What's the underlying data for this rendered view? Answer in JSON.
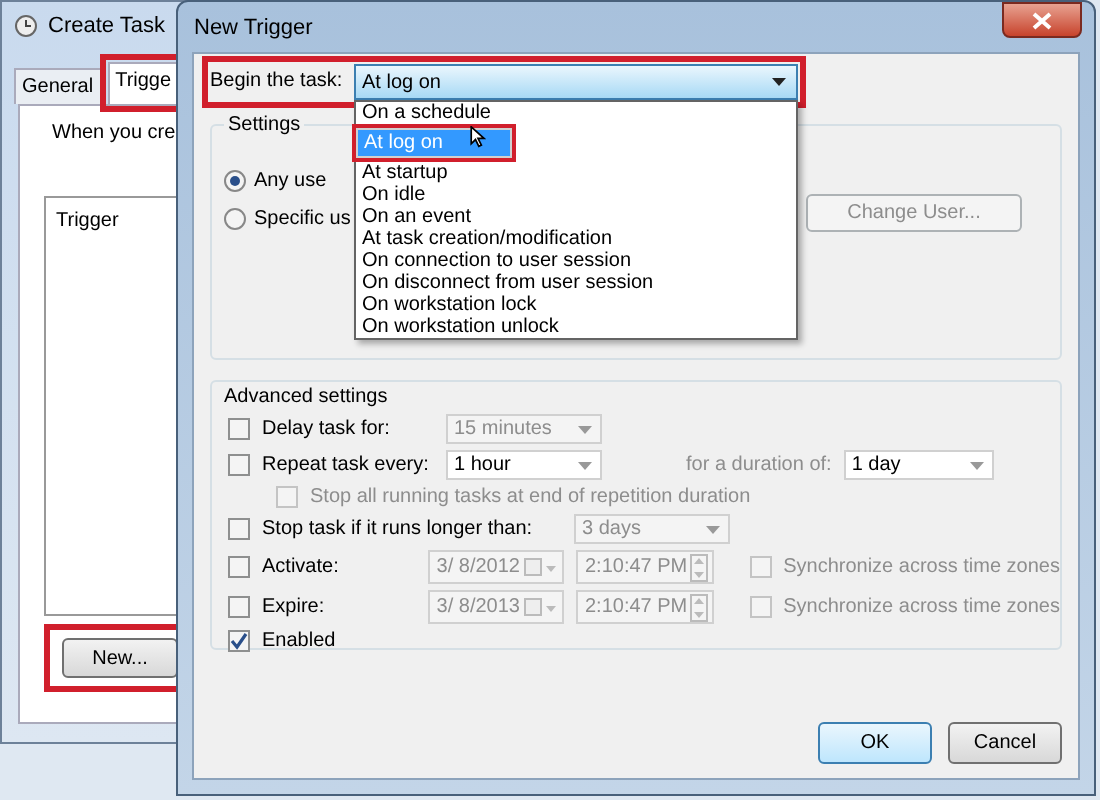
{
  "background_window": {
    "title": "Create Task",
    "tabs": [
      {
        "label": "General",
        "selected": false,
        "highlighted": false
      },
      {
        "label": "Trigge",
        "selected": true,
        "highlighted": true
      }
    ],
    "description": "When you cre",
    "list_header": "Trigger",
    "new_button": {
      "label": "New...",
      "highlighted": true
    }
  },
  "dialog": {
    "title": "New Trigger",
    "begin_label": "Begin the task:",
    "begin_value": "At log on",
    "begin_highlighted": true,
    "dropdown_options": [
      {
        "label": "On a schedule",
        "selected": false,
        "highlighted": false
      },
      {
        "label": "At log on",
        "selected": true,
        "highlighted": true
      },
      {
        "label": "At startup",
        "selected": false,
        "highlighted": false
      },
      {
        "label": "On idle",
        "selected": false,
        "highlighted": false
      },
      {
        "label": "On an event",
        "selected": false,
        "highlighted": false
      },
      {
        "label": "At task creation/modification",
        "selected": false,
        "highlighted": false
      },
      {
        "label": "On connection to user session",
        "selected": false,
        "highlighted": false
      },
      {
        "label": "On disconnect from user session",
        "selected": false,
        "highlighted": false
      },
      {
        "label": "On workstation lock",
        "selected": false,
        "highlighted": false
      },
      {
        "label": "On workstation unlock",
        "selected": false,
        "highlighted": false
      }
    ],
    "settings": {
      "title": "Settings",
      "options": [
        {
          "label": "Any use",
          "selected": true
        },
        {
          "label": "Specific us",
          "selected": false
        }
      ],
      "change_user_button": {
        "label": "Change User...",
        "disabled": true
      }
    },
    "advanced": {
      "title": "Advanced settings",
      "rows": [
        {
          "kind": "select",
          "label": "Delay task for:",
          "checked": false,
          "value": "15 minutes"
        },
        {
          "kind": "select",
          "label": "Repeat task every:",
          "checked": false,
          "value": "1 hour",
          "extra_label": "for a duration of:",
          "extra_value": "1 day"
        },
        {
          "kind": "subcheck",
          "label": "Stop all running tasks at end of repetition duration",
          "checked": false
        },
        {
          "kind": "select",
          "label": "Stop task if it runs longer than:",
          "checked": false,
          "value": "3 days"
        },
        {
          "kind": "datetime",
          "label": "Activate:",
          "checked": false,
          "date": "3/ 8/2012",
          "time": "2:10:47 PM",
          "sync_label": "Synchronize across time zones",
          "sync_checked": false
        },
        {
          "kind": "datetime",
          "label": "Expire:",
          "checked": false,
          "date": "3/ 8/2013",
          "time": "2:10:47 PM",
          "sync_label": "Synchronize across time zones",
          "sync_checked": false
        },
        {
          "kind": "check",
          "label": "Enabled",
          "checked": true
        }
      ]
    },
    "buttons": [
      {
        "label": "OK",
        "default": true
      },
      {
        "label": "Cancel",
        "default": false
      }
    ]
  }
}
